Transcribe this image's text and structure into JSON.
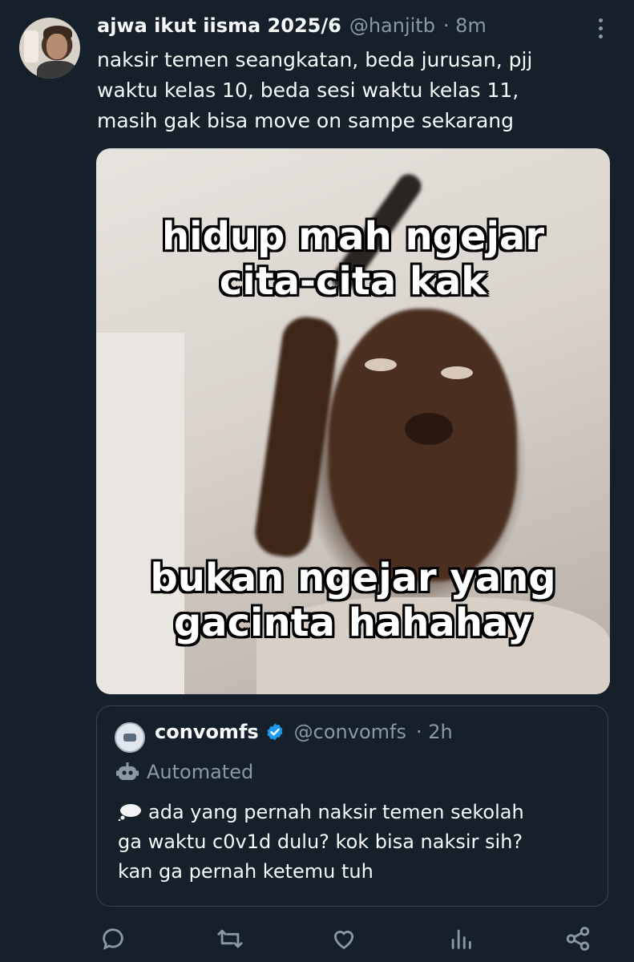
{
  "tweet": {
    "author_name": "ajwa ikut iisma 2025/6",
    "handle": "@hanjitb",
    "time": "· 8m",
    "text": "naksir temen seangkatan, beda jurusan, pjj\nwaktu kelas 10, beda sesi waktu kelas 11,\nmasih gak bisa move on sampe sekarang",
    "media": {
      "caption_top": "hidup mah ngejar\ncita-cita kak",
      "caption_bottom": "bukan ngejar yang\ngacinta hahahay"
    }
  },
  "quote": {
    "author_name": "convomfs",
    "handle": "@convomfs",
    "time": "· 2h",
    "label": "Automated",
    "text": "ada yang pernah naksir temen sekolah\nga waktu c0v1d dulu? kok bisa naksir sih?\nkan ga pernah ketemu tuh"
  },
  "actions": [
    "reply-icon",
    "retweet-icon",
    "like-icon",
    "views-icon",
    "share-icon"
  ],
  "colors": {
    "background": "#15202b",
    "text": "#f7f9f9",
    "muted": "#8b98a5",
    "border": "#38444d",
    "verified": "#1d9bf0"
  }
}
